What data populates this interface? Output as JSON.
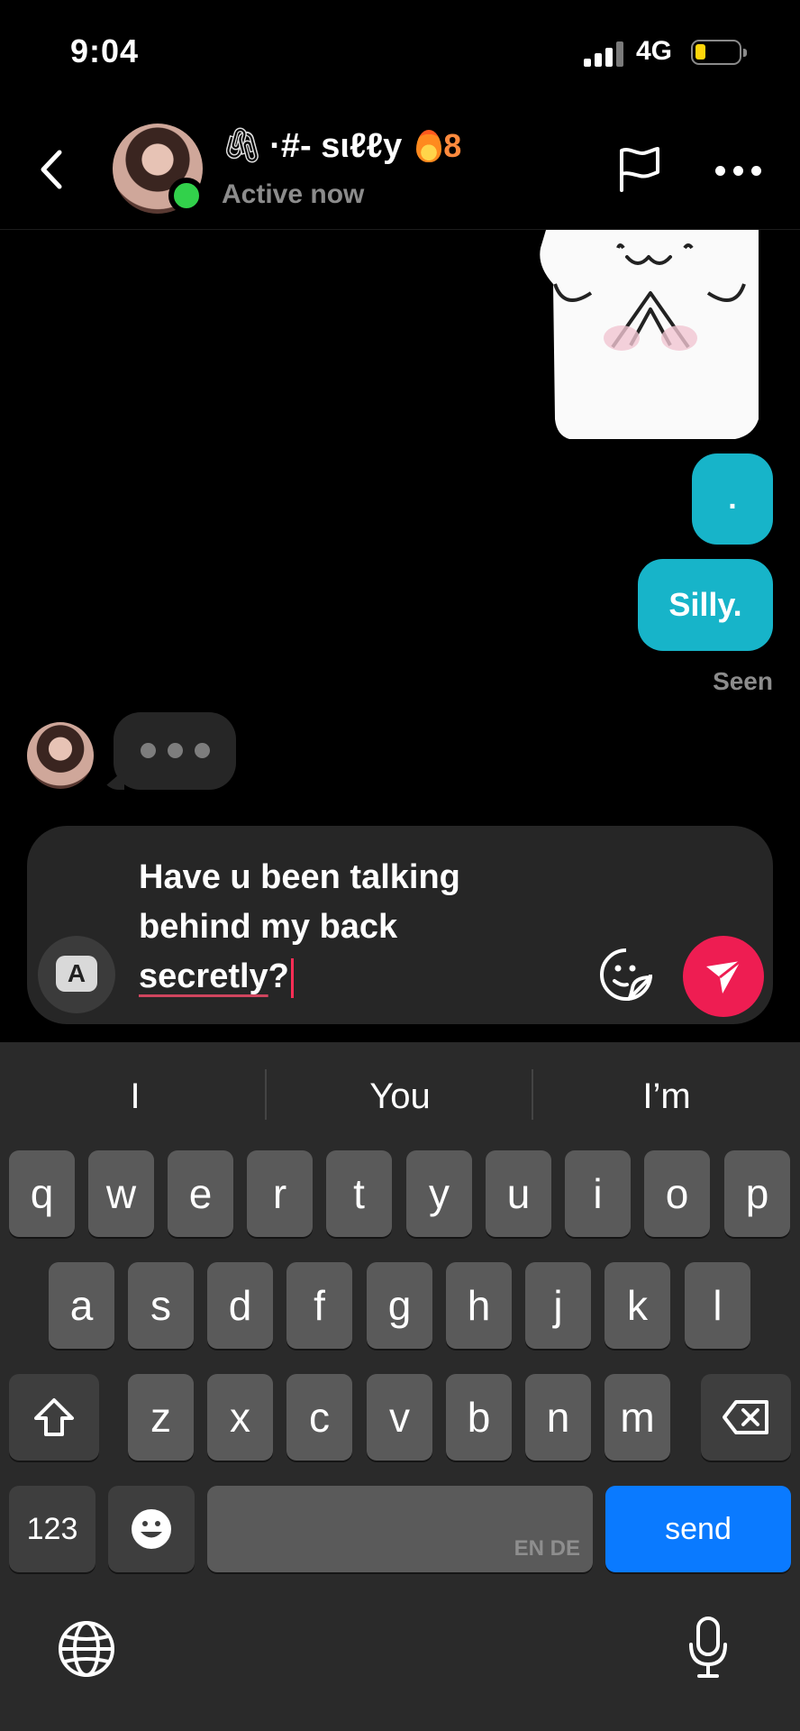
{
  "status_bar": {
    "time": "9:04",
    "network": "4G"
  },
  "header": {
    "title": "·#- sιℓℓy",
    "title_prefix": "🖇",
    "streak_count": "8",
    "presence": "Active now"
  },
  "messages": {
    "outgoing": [
      ".",
      "Silly."
    ],
    "seen_label": "Seen",
    "typing_indicator": true
  },
  "composer": {
    "lines": [
      "Have u been talking",
      "behind my back"
    ],
    "last_word": "secretly",
    "last_punct": "?",
    "keyboard_toggle_label": "A"
  },
  "keyboard": {
    "suggestions": [
      "I",
      "You",
      "I’m"
    ],
    "row1": [
      "q",
      "w",
      "e",
      "r",
      "t",
      "y",
      "u",
      "i",
      "o",
      "p"
    ],
    "row2": [
      "a",
      "s",
      "d",
      "f",
      "g",
      "h",
      "j",
      "k",
      "l"
    ],
    "row3": [
      "z",
      "x",
      "c",
      "v",
      "b",
      "n",
      "m"
    ],
    "numbers_label": "123",
    "space_label": "EN DE",
    "send_label": "send"
  },
  "colors": {
    "outgoing_bubble": "#17b4c9",
    "send_button": "#ee1d52",
    "keyboard_send": "#0a7aff",
    "online": "#32d14b"
  }
}
